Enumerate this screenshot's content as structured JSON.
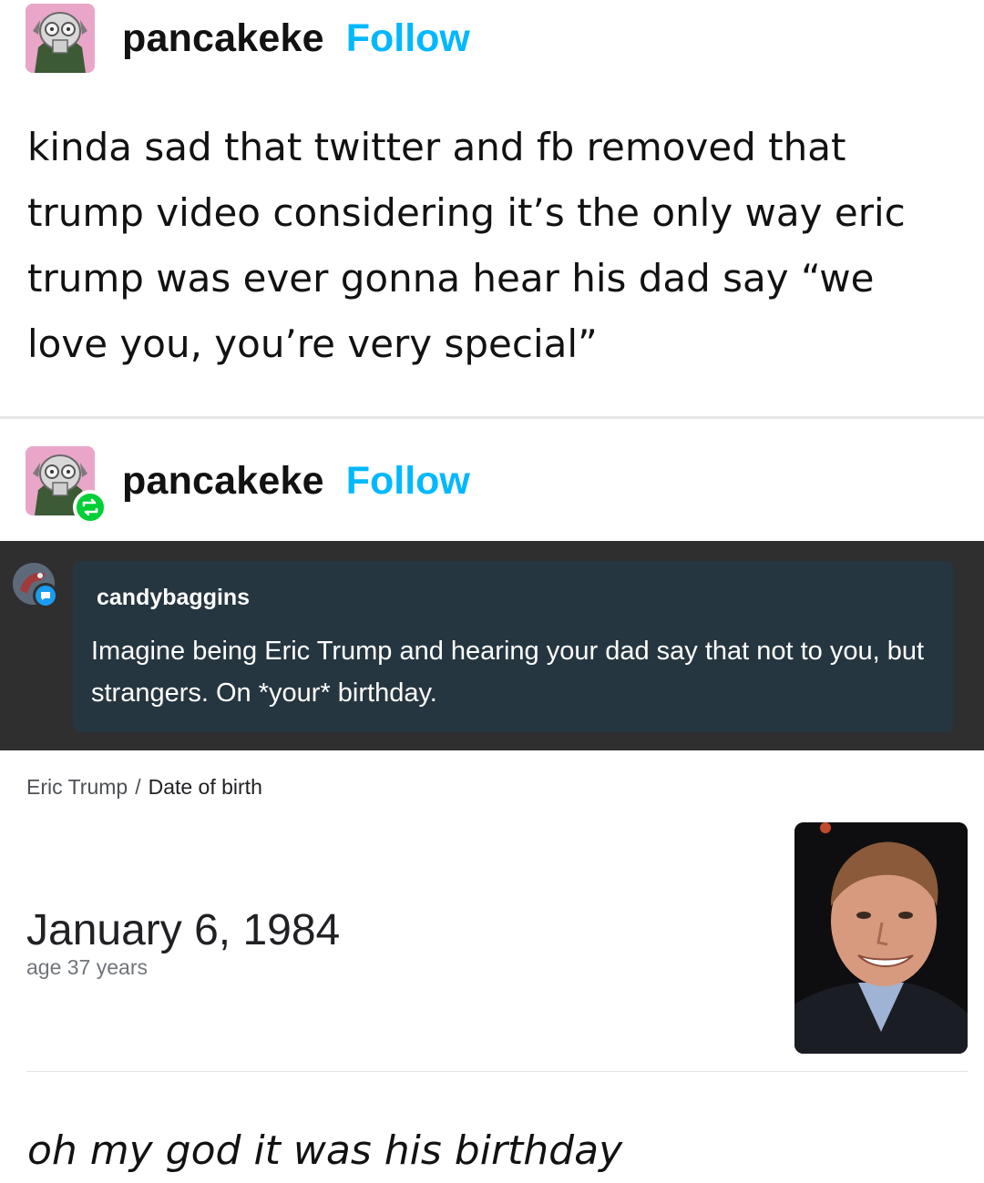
{
  "posts": [
    {
      "username": "pancakeke",
      "follow_label": "Follow",
      "body": "kinda sad that twitter and fb removed that trump video considering it’s the only way eric trump was ever gonna hear his dad say “we love you, you’re very special”"
    },
    {
      "username": "pancakeke",
      "follow_label": "Follow",
      "reblog_icon": "reblog-icon"
    }
  ],
  "reblogged_post": {
    "username": "candybaggins",
    "text": "Imagine being Eric Trump and hearing your dad say that not to you, but strangers. On *your* birthday."
  },
  "search_result": {
    "breadcrumb_entity": "Eric Trump",
    "breadcrumb_separator": "/",
    "breadcrumb_attribute": "Date of birth",
    "date_of_birth": "January 6, 1984",
    "age": "age 37 years"
  },
  "reply": {
    "text": "oh my god it was his birthday"
  },
  "colors": {
    "follow": "#00b8ff",
    "reblog_badge": "#00cf35",
    "dark_background": "#2f2f2f",
    "dark_card": "#263640"
  }
}
